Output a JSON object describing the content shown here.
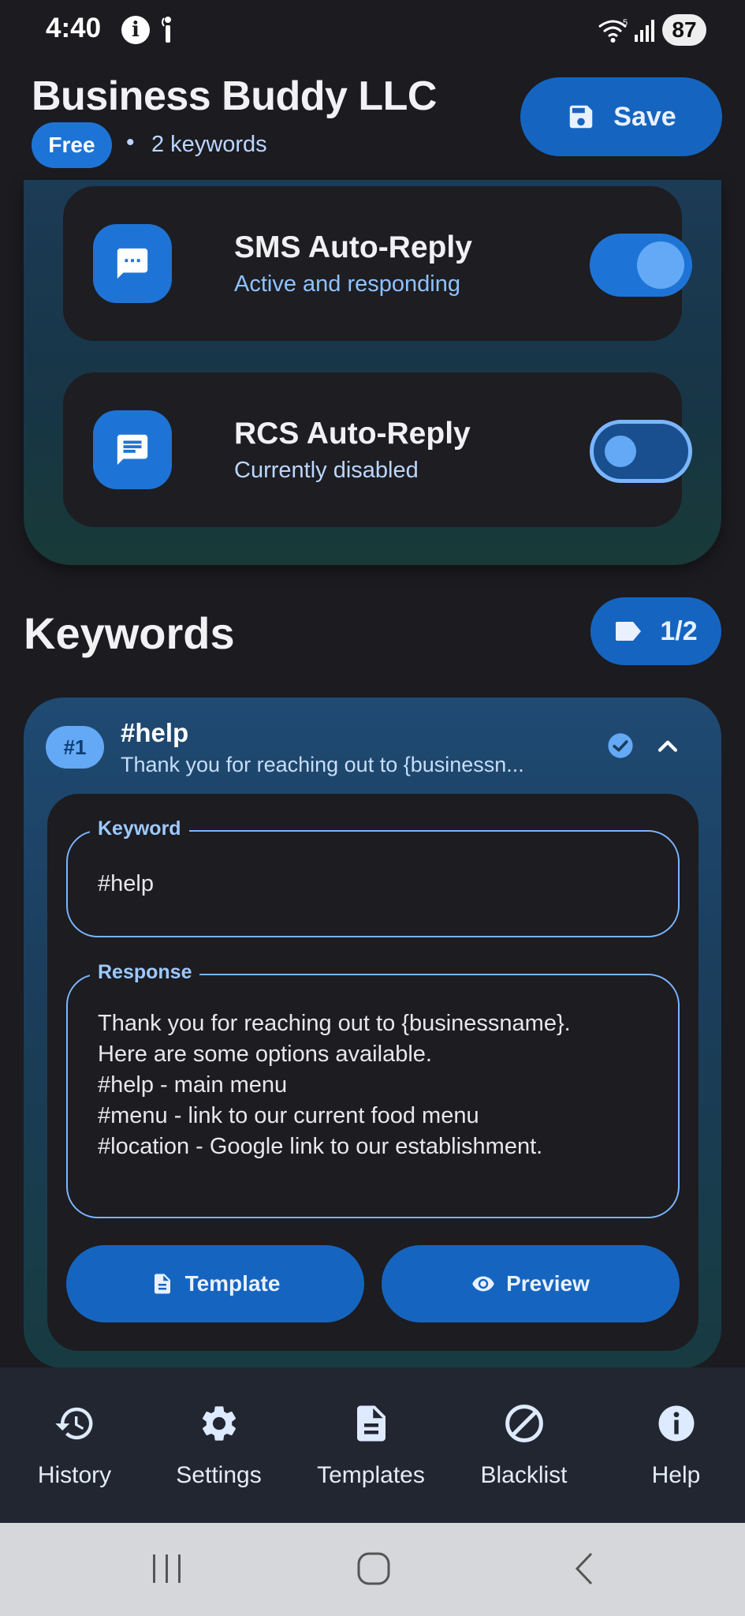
{
  "status_bar": {
    "time": "4:40",
    "battery": "87",
    "wifi_badge": "5"
  },
  "header": {
    "title": "Business Buddy LLC",
    "plan": "Free",
    "separator": "•",
    "keyword_count": "2 keywords",
    "save_label": "Save"
  },
  "auto_reply": {
    "sms": {
      "title": "SMS Auto-Reply",
      "subtitle": "Active and responding",
      "enabled": true
    },
    "rcs": {
      "title": "RCS Auto-Reply",
      "subtitle": "Currently disabled",
      "enabled": false
    }
  },
  "keywords": {
    "heading": "Keywords",
    "counter": "1/2",
    "items": [
      {
        "number": "#1",
        "name": "#help",
        "preview": "Thank you for reaching out to {businessn...",
        "keyword_label": "Keyword",
        "keyword_value": "#help",
        "response_label": "Response",
        "response_lines": [
          "Thank you for reaching out to {businessname}.",
          "Here are some options available.",
          "#help - main menu",
          "#menu - link to our current food menu",
          "#location - Google link to our establishment."
        ],
        "template_label": "Template",
        "preview_label": "Preview"
      }
    ]
  },
  "bottom_nav": [
    {
      "label": "History",
      "icon": "history-icon"
    },
    {
      "label": "Settings",
      "icon": "gear-icon"
    },
    {
      "label": "Templates",
      "icon": "document-icon"
    },
    {
      "label": "Blacklist",
      "icon": "block-icon"
    },
    {
      "label": "Help",
      "icon": "info-icon"
    }
  ],
  "colors": {
    "accent": "#1565c0",
    "accent_light": "#64a9f5",
    "background": "#1b1b20",
    "card": "#1d1d22"
  }
}
